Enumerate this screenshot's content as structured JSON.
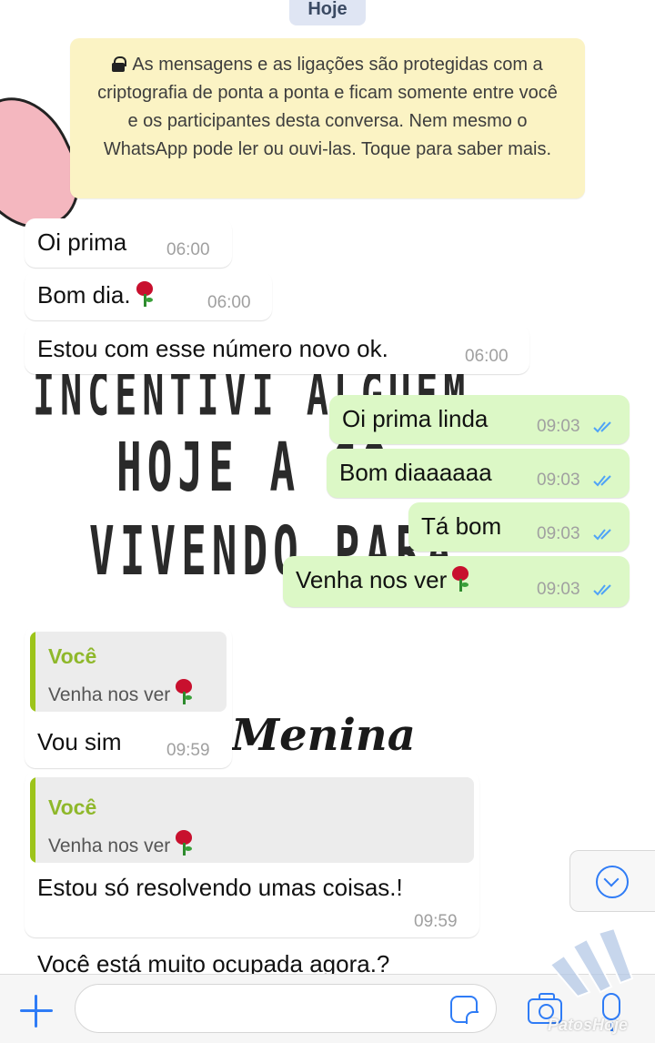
{
  "date_chip": "Hoje",
  "encryption_notice": "As mensagens e as ligações são protegidas com a criptografia de ponta a ponta e ficam somente entre você e os participantes desta conversa. Nem mesmo o WhatsApp pode ler ou ouvi-las. Toque para saber mais.",
  "messages": [
    {
      "text": "Oi prima",
      "time": "06:00"
    },
    {
      "text": "Bom dia.",
      "time": "06:00"
    },
    {
      "text": "Estou com esse número novo ok.",
      "time": "06:00"
    },
    {
      "text": "Oi prima linda",
      "time": "09:03"
    },
    {
      "text": "Bom diaaaaaa",
      "time": "09:03"
    },
    {
      "text": "Tá bom",
      "time": "09:03"
    },
    {
      "text": "Venha nos ver",
      "time": "09:03"
    },
    {
      "quote_author": "Você",
      "quote_text": "Venha nos ver",
      "text": "Vou sim",
      "time": "09:59"
    },
    {
      "quote_author": "Você",
      "quote_text": "Venha nos ver",
      "text": "Estou só resolvendo umas coisas.!",
      "time": "09:59"
    },
    {
      "text": "Você está muito ocupada agora.?"
    }
  ],
  "wallpaper": {
    "line1": "INCENTIVI ALGUEM",
    "line2": "HOJE A CO",
    "line3": "VIVENDO PARA",
    "script": "Menina"
  },
  "watermark": "PatosHoje",
  "colors": {
    "incoming_bubble": "#ffffff",
    "outgoing_bubble": "#dcf8c6",
    "notice_bg": "#fbf3c4",
    "accent_blue": "#2f7cf6",
    "quote_bar": "#9dc41a",
    "read_ticks": "#4fa3f7"
  },
  "icons": [
    "lock-icon",
    "rose-emoji-icon",
    "double-check-icon",
    "chevron-down-icon",
    "plus-icon",
    "sticker-icon",
    "camera-icon",
    "microphone-icon"
  ]
}
